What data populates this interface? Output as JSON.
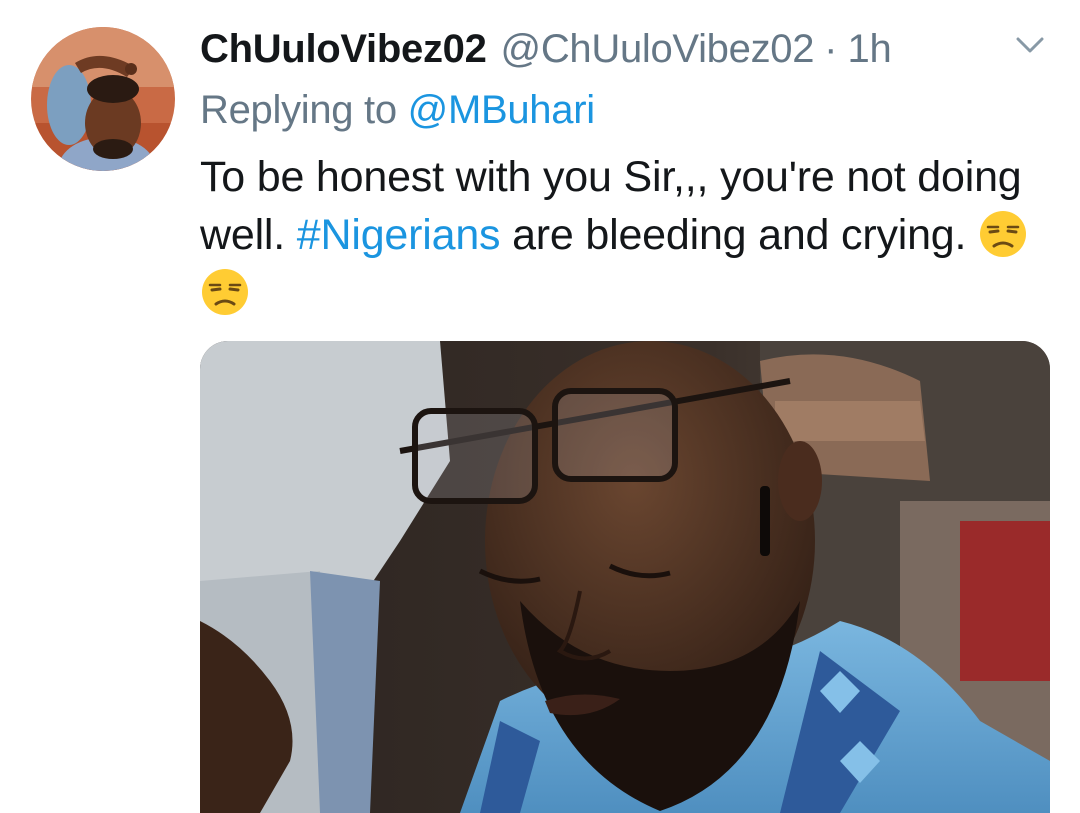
{
  "tweet": {
    "display_name": "ChUuloVibez02",
    "handle": "@ChUuloVibez02",
    "separator": "·",
    "time": "1h",
    "replying_prefix": "Replying to",
    "replying_to": "@MBuhari",
    "text_part1": "To be honest with you Sir,,, you're not doing well.",
    "hashtag": "#Nigerians",
    "text_part2": "are bleeding and crying.",
    "emojis": [
      "unamused-face-emoji",
      "unamused-face-emoji"
    ]
  },
  "icons": {
    "more": "chevron-down-icon"
  },
  "colors": {
    "text": "#14171a",
    "secondary": "#657786",
    "link": "#1b95e0",
    "background": "#ffffff"
  }
}
